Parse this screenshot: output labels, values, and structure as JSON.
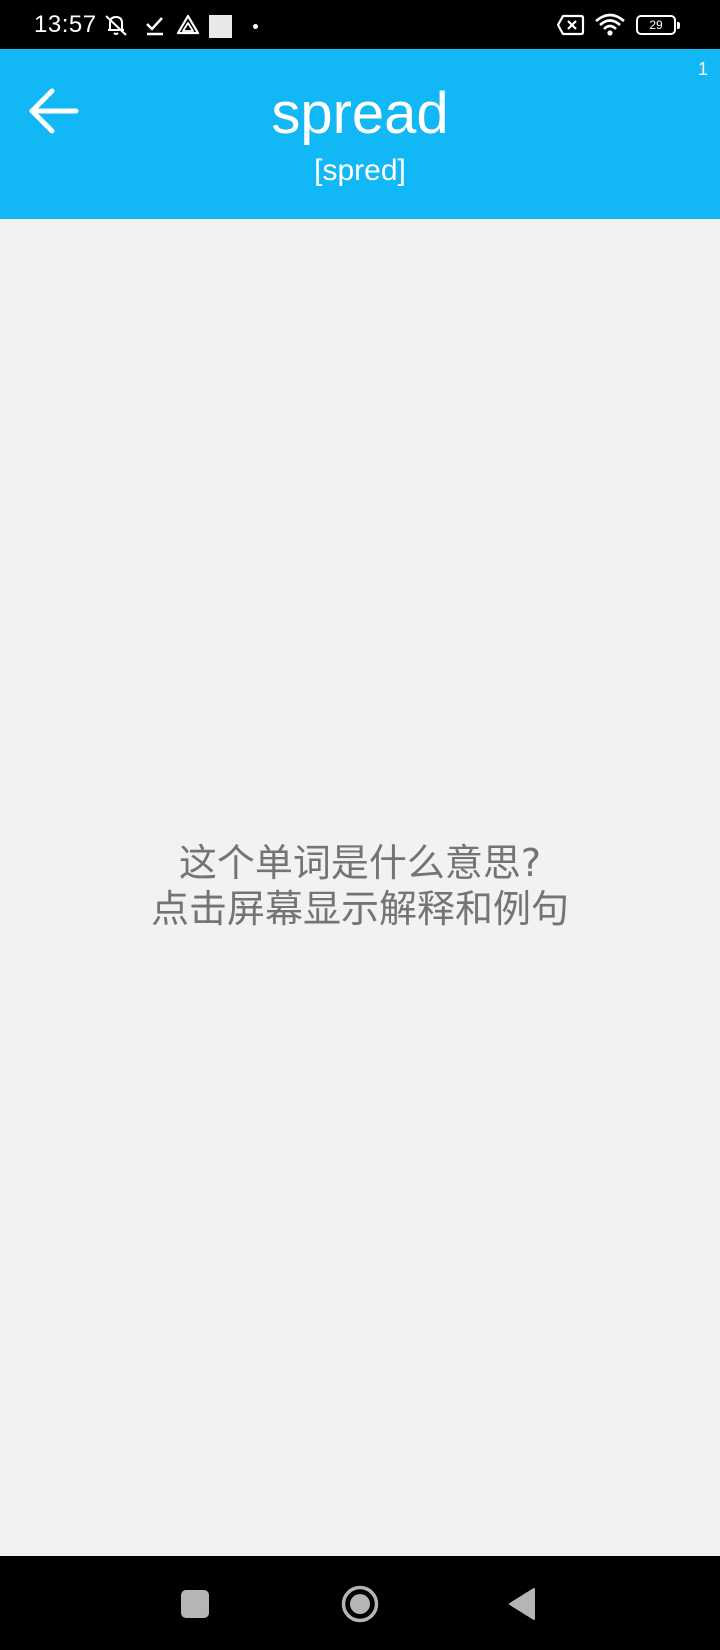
{
  "status_bar": {
    "time": "13:57",
    "battery_level": "29",
    "icons": [
      "notifications-muted-icon",
      "check-icon",
      "drive-icon",
      "app-square-icon",
      "dot-icon",
      "sim-disabled-icon",
      "wifi-icon",
      "battery-icon"
    ]
  },
  "header": {
    "word": "spread",
    "phonetic": "[spred]",
    "counter": "1",
    "back_icon": "arrow-left-icon"
  },
  "content": {
    "prompt_line1": "这个单词是什么意思?",
    "prompt_line2": "点击屏幕显示解释和例句"
  },
  "nav_bar": {
    "buttons": [
      "recents-button",
      "home-button",
      "back-button"
    ]
  },
  "colors": {
    "header_bg": "#12b7f5",
    "content_bg": "#f2f2f2",
    "prompt_text": "#747474"
  }
}
